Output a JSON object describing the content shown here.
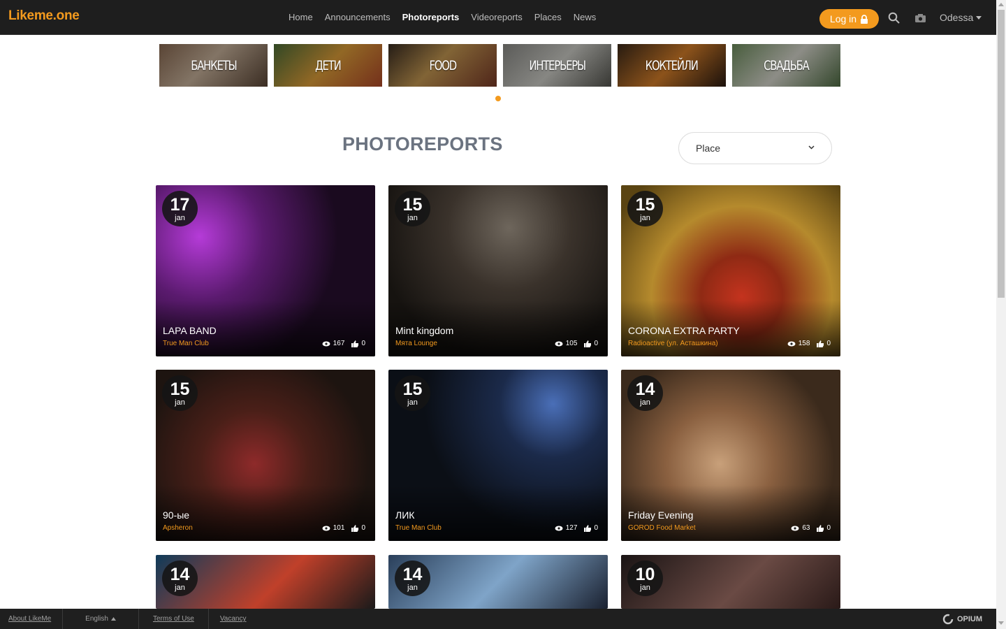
{
  "header": {
    "logo": "Likeme.one",
    "nav": [
      "Home",
      "Announcements",
      "Photoreports",
      "Videoreports",
      "Places",
      "News"
    ],
    "active_nav": "Photoreports",
    "login_label": "Log in",
    "city": "Odessa"
  },
  "categories": [
    "БАНКЕТЫ",
    "ДЕТИ",
    "FOOD",
    "ИНТЕРЬЕРЫ",
    "КОКТЕЙЛИ",
    "СВАДЬБА"
  ],
  "main": {
    "title": "PHOTOREPORTS",
    "place_placeholder": "Place"
  },
  "cards": [
    {
      "day": "17",
      "month": "jan",
      "title": "LAPA BAND",
      "place": "True Man Club",
      "views": "167",
      "likes": "0"
    },
    {
      "day": "15",
      "month": "jan",
      "title": "Mint kingdom",
      "place": "Мята Lounge",
      "views": "105",
      "likes": "0"
    },
    {
      "day": "15",
      "month": "jan",
      "title": "CORONA EXTRA PARTY",
      "place": "Radioactive (ул. Асташкина)",
      "views": "158",
      "likes": "0"
    },
    {
      "day": "15",
      "month": "jan",
      "title": "90-ые",
      "place": "Apsheron",
      "views": "101",
      "likes": "0"
    },
    {
      "day": "15",
      "month": "jan",
      "title": "ЛИК",
      "place": "True Man Club",
      "views": "127",
      "likes": "0"
    },
    {
      "day": "14",
      "month": "jan",
      "title": "Friday Evening",
      "place": "GOROD Food Market",
      "views": "63",
      "likes": "0"
    },
    {
      "day": "14",
      "month": "jan"
    },
    {
      "day": "14",
      "month": "jan"
    },
    {
      "day": "10",
      "month": "jan"
    }
  ],
  "footer": {
    "about": "About LikeMe",
    "language": "English",
    "terms": "Terms of Use",
    "vacancy": "Vacancy",
    "brand": "OPIUM"
  },
  "colors": {
    "accent": "#f39a1e",
    "topbar": "#1e1e1e",
    "title": "#6b7380"
  }
}
